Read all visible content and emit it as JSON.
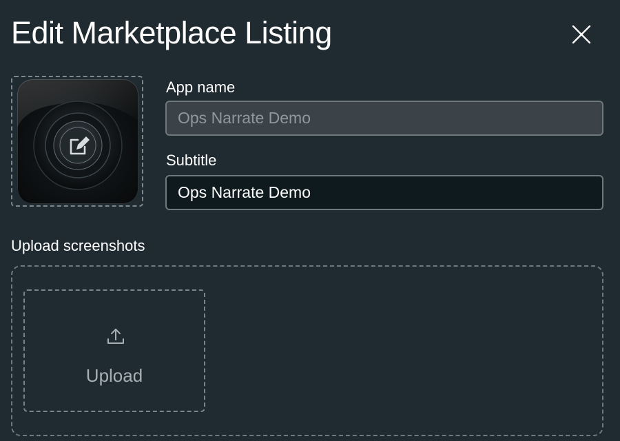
{
  "dialog": {
    "title": "Edit Marketplace Listing",
    "close_icon": "close-icon"
  },
  "app_icon": {
    "icon": "edit-icon"
  },
  "fields": {
    "app_name": {
      "label": "App name",
      "value": "Ops Narrate Demo"
    },
    "subtitle": {
      "label": "Subtitle",
      "value": "Ops Narrate Demo"
    }
  },
  "screenshots": {
    "label": "Upload screenshots",
    "upload_label": "Upload",
    "upload_icon": "upload-icon"
  },
  "colors": {
    "background": "#1f2a31",
    "text": "#ffffff",
    "muted_text": "#a7afb4",
    "border": "#6f787e",
    "disabled_input_bg": "#3b4248",
    "active_input_bg": "#0f1a1e"
  }
}
